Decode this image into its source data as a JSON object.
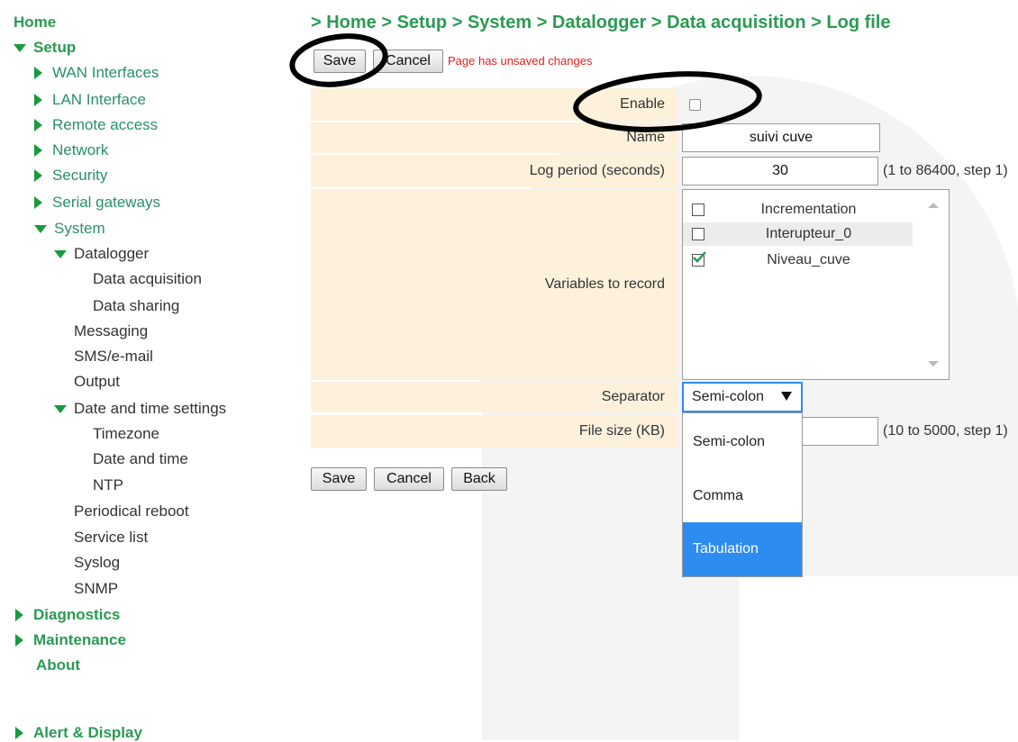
{
  "breadcrumb": "> Home > Setup > System > Datalogger > Data acquisition > Log file",
  "toolbar_top": {
    "save": "Save",
    "cancel": "Cancel",
    "status": "Page has unsaved changes"
  },
  "toolbar_bottom": {
    "save": "Save",
    "cancel": "Cancel",
    "back": "Back"
  },
  "sidebar": {
    "home": "Home",
    "setup": "Setup",
    "wan": "WAN Interfaces",
    "lan": "LAN Interface",
    "remote": "Remote access",
    "network": "Network",
    "security": "Security",
    "serial": "Serial gateways",
    "system": "System",
    "datalogger": "Datalogger",
    "data_acquisition": "Data acquisition",
    "data_sharing": "Data sharing",
    "messaging": "Messaging",
    "sms": "SMS/e-mail",
    "output": "Output",
    "datetime_settings": "Date and time settings",
    "timezone": "Timezone",
    "date_time": "Date and time",
    "ntp": "NTP",
    "periodical_reboot": "Periodical reboot",
    "service_list": "Service list",
    "syslog": "Syslog",
    "snmp": "SNMP",
    "diagnostics": "Diagnostics",
    "maintenance": "Maintenance",
    "about": "About",
    "alert_display": "Alert & Display"
  },
  "form": {
    "enable_label": "Enable",
    "enable_checked": false,
    "name_label": "Name",
    "name_value": "suivi cuve",
    "log_period_label": "Log period (seconds)",
    "log_period_value": "30",
    "log_period_hint": "(1 to 86400, step 1)",
    "variables_label": "Variables to record",
    "variables": [
      {
        "name": "Incrementation",
        "checked": false
      },
      {
        "name": "Interupteur_0",
        "checked": false
      },
      {
        "name": "Niveau_cuve",
        "checked": true
      }
    ],
    "separator_label": "Separator",
    "separator_value": "Semi-colon",
    "separator_options": [
      "Semi-colon",
      "Comma",
      "Tabulation"
    ],
    "separator_highlighted": "Tabulation",
    "file_size_label": "File size (KB)",
    "file_size_hint": "(10 to 5000, step 1)"
  },
  "colors": {
    "accent_green": "#2a9a53",
    "label_bg": "#fdf1dc",
    "highlight_blue": "#2d8cf0",
    "warning_red": "#e0201e"
  }
}
